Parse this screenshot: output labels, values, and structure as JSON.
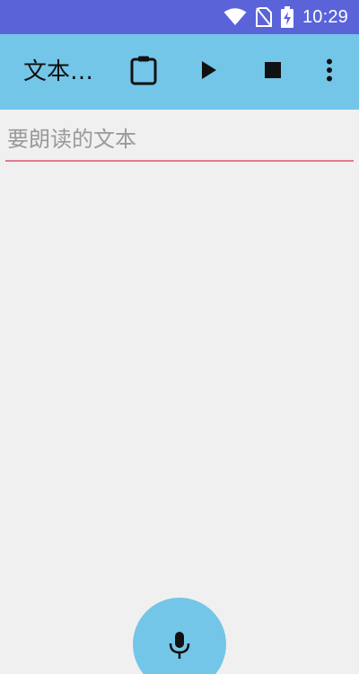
{
  "status_bar": {
    "time": "10:29",
    "background": "#5b63d9",
    "icons": [
      "wifi-icon",
      "no-sim-icon",
      "battery-charging-icon"
    ]
  },
  "toolbar": {
    "title": "文本…",
    "background": "#74c6e8",
    "actions": [
      "clipboard-icon",
      "play-icon",
      "stop-icon",
      "more-vert-icon"
    ]
  },
  "main": {
    "input_placeholder": "要朗读的文本",
    "input_value": "",
    "underline_color": "#e07a8e"
  },
  "fab": {
    "icon": "microphone-icon",
    "background": "#74c6e8"
  }
}
